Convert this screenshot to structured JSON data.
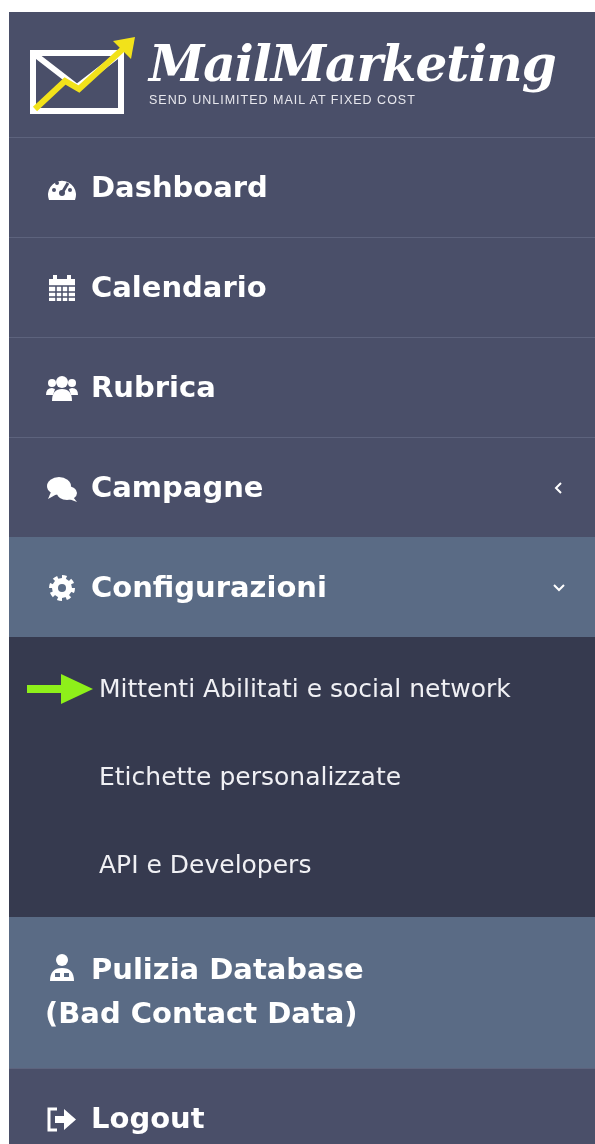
{
  "logo": {
    "title": "MailMarketing",
    "tagline": "SEND UNLIMITED MAIL AT FIXED COST"
  },
  "menu": [
    {
      "label": "Dashboard",
      "highlighted": false
    },
    {
      "label": "Calendario",
      "highlighted": false
    },
    {
      "label": "Rubrica",
      "highlighted": false
    },
    {
      "label": "Campagne",
      "highlighted": false,
      "expanded": false
    },
    {
      "label": "Configurazioni",
      "highlighted": true,
      "expanded": true,
      "children": [
        {
          "label": "Mittenti Abilitati e social network",
          "pointed": true
        },
        {
          "label": "Etichette personalizzate",
          "pointed": false
        },
        {
          "label": "API e Developers",
          "pointed": false
        }
      ]
    },
    {
      "label": "Pulizia Database (Bad Contact Data)",
      "highlighted": true
    },
    {
      "label": "Logout",
      "highlighted": false
    }
  ]
}
